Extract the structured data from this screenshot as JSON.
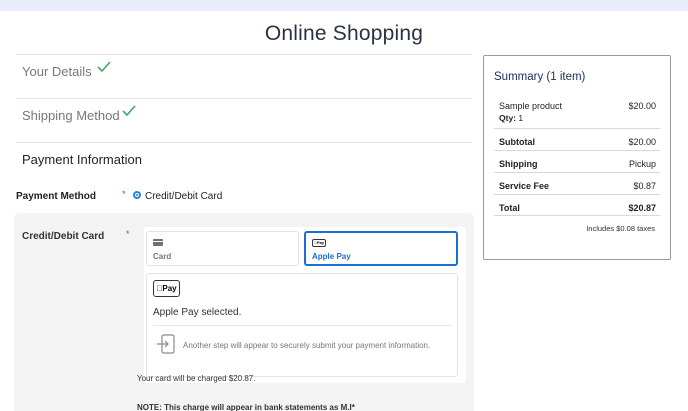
{
  "page": {
    "title": "Online Shopping"
  },
  "steps": {
    "details": "Your Details",
    "shipping": "Shipping Method",
    "payment": "Payment Information"
  },
  "payment": {
    "method_label": "Payment Method",
    "required_mark": "*",
    "method_option": "Credit/Debit Card",
    "card_section_label": "Credit/Debit Card",
    "tabs": {
      "card": "Card",
      "apple": "Apple Pay"
    },
    "apple_badge": "Pay",
    "apple_mini": "Pay",
    "selected_text": "Apple Pay selected.",
    "another_step_note": "Another step will appear to securely submit your payment information.",
    "charge_text": "Your card will be charged $20.87.",
    "note_text": "NOTE: This charge will appear in bank statements as M.I*"
  },
  "summary": {
    "title": "Summary (1 item)",
    "product": "Sample product",
    "qty_label": "Qty:",
    "qty_value": "1",
    "product_price": "$20.00",
    "rows": [
      {
        "label": "Subtotal",
        "value": "$20.00"
      },
      {
        "label": "Shipping",
        "value": "Pickup"
      },
      {
        "label": "Service Fee",
        "value": "$0.87"
      },
      {
        "label": "Total",
        "value": "$20.87"
      }
    ],
    "taxes": "Includes $0.08 taxes"
  },
  "colors": {
    "accent": "#1a6ed8",
    "check": "#3fa86b",
    "title": "#2a3441",
    "summary_title": "#1b2f57"
  }
}
